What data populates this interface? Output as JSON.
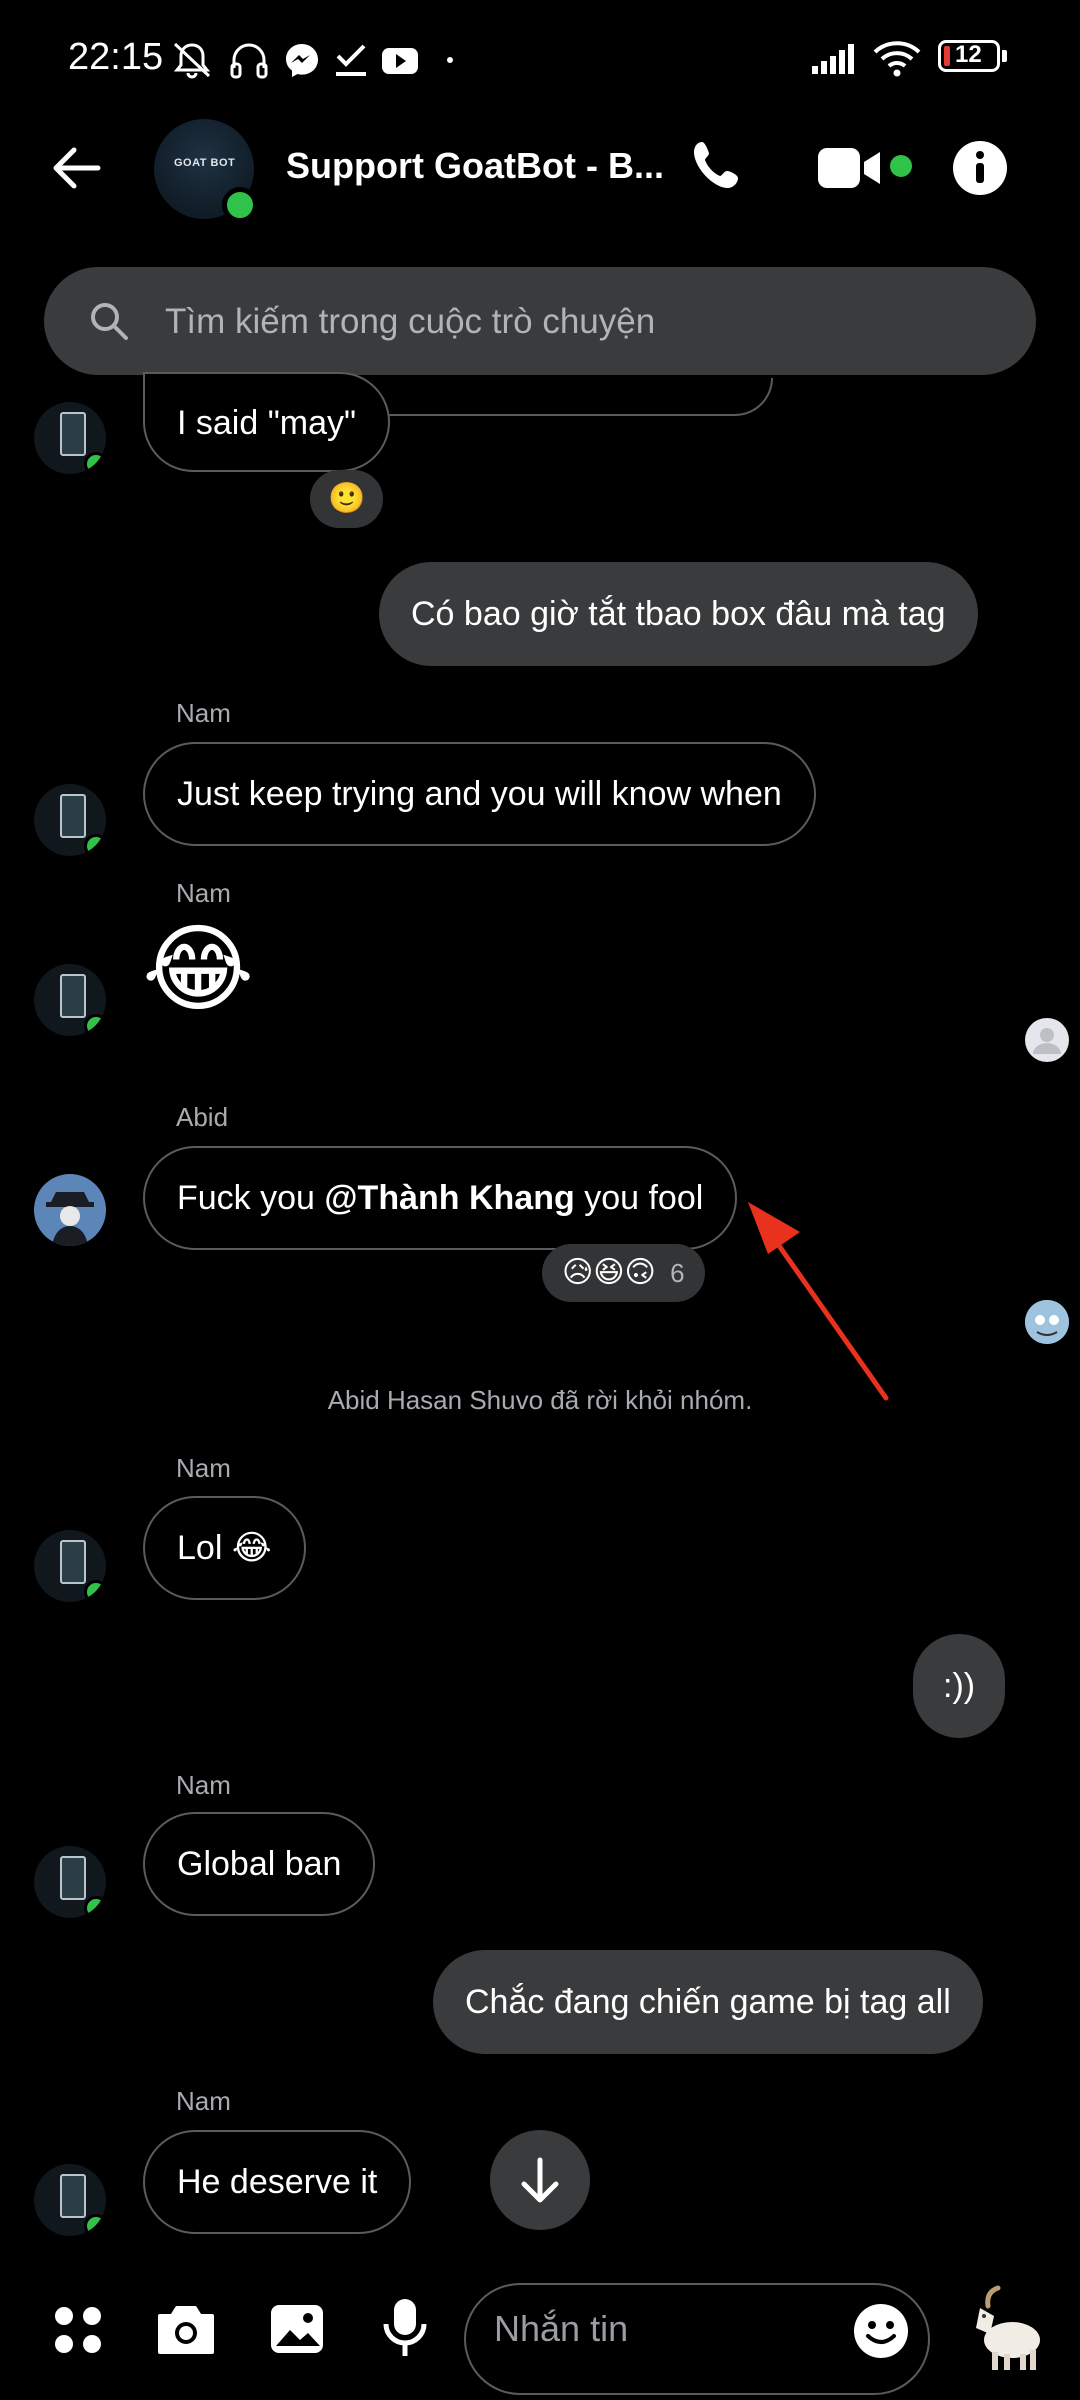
{
  "status_bar": {
    "time": "22:15",
    "battery": "12",
    "icons": [
      "mute-bell-icon",
      "headphones-icon",
      "messenger-icon",
      "done-check-icon",
      "youtube-icon",
      "dot-icon",
      "signal-icon",
      "wifi-icon",
      "battery-icon"
    ]
  },
  "header": {
    "title": "Support GoatBot - B...",
    "group_avatar_text": "GOAT BOT",
    "icons": [
      "back-arrow-icon",
      "phone-icon",
      "video-icon",
      "info-icon"
    ]
  },
  "search": {
    "placeholder": "Tìm kiếm trong cuộc trò chuyện"
  },
  "messages": [
    {
      "text": "I said \"may\"",
      "reaction": "🙂"
    },
    {
      "text": "Có bao giờ tắt tbao box đâu mà tag"
    },
    {
      "sender": "Nam",
      "text": "Just keep trying and you will know when"
    },
    {
      "sender": "Nam",
      "emoji": "😂"
    },
    {
      "sender": "Abid",
      "text_before": "Fuck you ",
      "mention": "@Thành Khang",
      "text_after": " you fool",
      "reactions": "😥😆🙃",
      "reaction_count": "6"
    },
    {
      "system": "Abid Hasan Shuvo đã rời khỏi nhóm."
    },
    {
      "sender": "Nam",
      "text": "Lol 😂"
    },
    {
      "text": ":))"
    },
    {
      "sender": "Nam",
      "text": "Global ban"
    },
    {
      "text": "Chắc đang chiến game bị tag all"
    },
    {
      "sender": "Nam",
      "text": "He deserve it"
    }
  ],
  "composer": {
    "placeholder": "Nhắn tin",
    "icons": [
      "apps-grid-icon",
      "camera-icon",
      "gallery-icon",
      "microphone-icon",
      "emoji-icon",
      "goat-sticker-icon"
    ]
  },
  "colors": {
    "online": "#31c24a",
    "bubble_out": "#3a3b3c",
    "annotation": "#e8321e"
  }
}
